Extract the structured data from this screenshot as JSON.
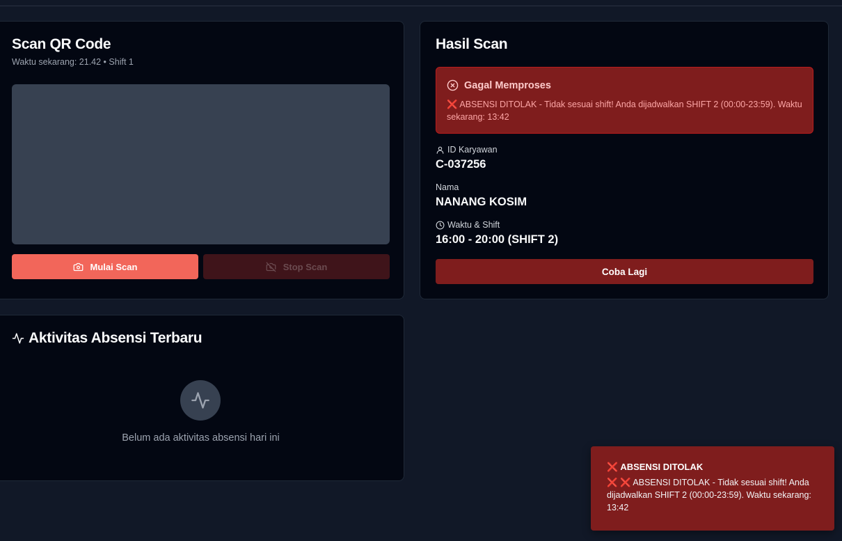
{
  "scan": {
    "title": "Scan QR Code",
    "subtitle": "Waktu sekarang: 21.42 • Shift 1",
    "start_label": "Mulai Scan",
    "stop_label": "Stop Scan"
  },
  "result": {
    "title": "Hasil Scan",
    "error_title": "Gagal Memproses",
    "error_x": "❌",
    "error_message": "ABSENSI DITOLAK - Tidak sesuai shift! Anda dijadwalkan SHIFT 2 (00:00-23:59). Waktu sekarang: 13:42",
    "employee_id_label": "ID Karyawan",
    "employee_id": "C-037256",
    "name_label": "Nama",
    "name": "NANANG KOSIM",
    "time_label": "Waktu & Shift",
    "time_value": "16:00 - 20:00 (SHIFT 2)",
    "retry_label": "Coba Lagi"
  },
  "activity": {
    "title": "Aktivitas Absensi Terbaru",
    "empty_text": "Belum ada aktivitas absensi hari ini"
  },
  "toast": {
    "x": "❌",
    "title": "ABSENSI DITOLAK",
    "message_x": "❌ ❌",
    "message": "ABSENSI DITOLAK - Tidak sesuai shift! Anda dijadwalkan SHIFT 2 (00:00-23:59). Waktu sekarang: 13:42"
  },
  "colors": {
    "background": "#111827",
    "card": "#030712",
    "accent": "#f2665a",
    "danger": "#7f1d1d"
  }
}
